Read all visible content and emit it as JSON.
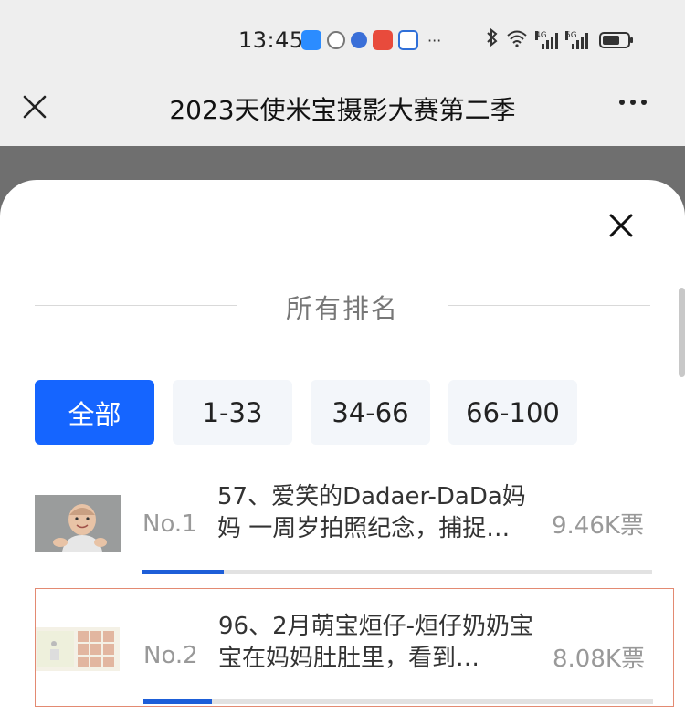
{
  "status_bar": {
    "time": "13:45",
    "icons": [
      "weather-icon",
      "hexagon-icon",
      "music-icon",
      "red-app-icon",
      "pet-icon"
    ],
    "more": "···",
    "bluetooth": "bluetooth-icon",
    "wifi": "wifi-icon",
    "signal_1": "4G",
    "signal_2": "5G",
    "battery": "battery-icon"
  },
  "nav": {
    "title": "2023天使米宝摄影大赛第二季"
  },
  "sheet": {
    "title": "所有排名",
    "tabs": [
      {
        "label": "全部",
        "active": true
      },
      {
        "label": "1-33",
        "active": false
      },
      {
        "label": "34-66",
        "active": false
      },
      {
        "label": "66-100",
        "active": false
      }
    ],
    "items": [
      {
        "rank": "No.1",
        "description": "57、爱笑的Dadaer-DaDa妈妈 一周岁拍照纪念，捕捉…",
        "votes": "9.46K票",
        "progress": 0.16
      },
      {
        "rank": "No.2",
        "description": "96、2月萌宝烜仔-烜仔奶奶宝宝在妈妈肚肚里，看到…",
        "votes": "8.08K票",
        "progress": 0.135
      }
    ]
  },
  "colors": {
    "accent": "#1565ff",
    "progress": "#1d5ed8",
    "highlight_border": "#e38a72"
  }
}
